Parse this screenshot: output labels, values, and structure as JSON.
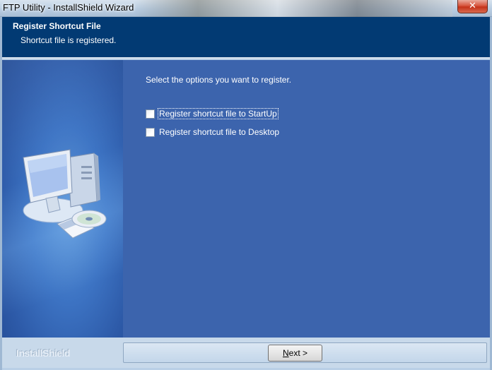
{
  "window": {
    "title": "FTP Utility - InstallShield Wizard",
    "close_glyph": "✕"
  },
  "header": {
    "title": "Register Shortcut File",
    "subtitle": "Shortcut file is registered."
  },
  "main": {
    "prompt": "Select the options you want to register.",
    "options": [
      {
        "label": "Register shortcut file to StartUp",
        "checked": false,
        "focused": true
      },
      {
        "label": "Register shortcut file to Desktop",
        "checked": false,
        "focused": false
      }
    ]
  },
  "footer": {
    "brand": "InstallShield",
    "next_label_access": "N",
    "next_label_rest": "ext >"
  },
  "icons": {
    "side_art": "computer-with-cd-icon",
    "close": "close-icon"
  },
  "colors": {
    "header_bg": "#023a73",
    "content_bg": "#3c64ad",
    "close_red": "#c5321a"
  }
}
